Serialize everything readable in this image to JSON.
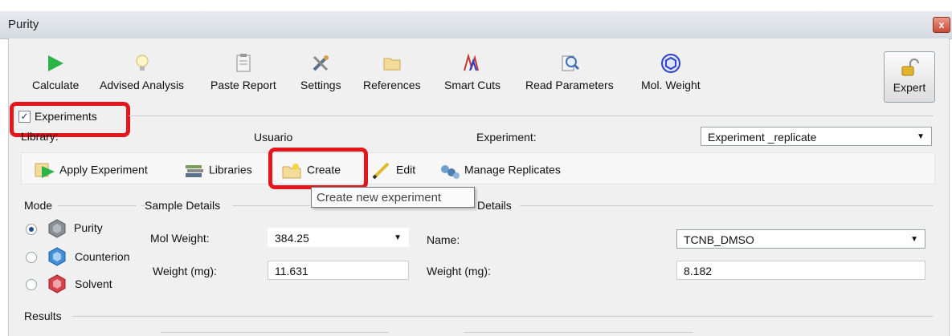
{
  "window": {
    "title": "Purity",
    "close_label": "x"
  },
  "toolbar": {
    "calculate": "Calculate",
    "advised_analysis": "Advised Analysis",
    "paste_report": "Paste Report",
    "settings": "Settings",
    "references": "References",
    "smart_cuts": "Smart Cuts",
    "read_parameters": "Read Parameters",
    "mol_weight": "Mol. Weight",
    "expert": "Expert"
  },
  "experiments": {
    "checkbox_label": "Experiments",
    "checked": true,
    "check_mark": "✓",
    "library_label": "Library:",
    "library_value": "Usuario",
    "experiment_label": "Experiment:",
    "experiment_value": "Experiment _replicate",
    "apply_experiment": "Apply Experiment",
    "libraries": "Libraries",
    "create": "Create",
    "edit": "Edit",
    "manage_replicates": "Manage Replicates",
    "tooltip": "Create new experiment"
  },
  "mode": {
    "title": "Mode",
    "options": [
      "Purity",
      "Counterion",
      "Solvent"
    ],
    "selected": "Purity"
  },
  "sample_details": {
    "title": "Sample Details",
    "mol_weight_label": "Mol Weight:",
    "mol_weight_value": "384.25",
    "weight_label": "Weight (mg):",
    "weight_value": "11.631"
  },
  "reference_details": {
    "title_visible_part": "Details",
    "name_label": "Name:",
    "name_value": "TCNB_DMSO",
    "weight_label": "Weight (mg):",
    "weight_value": "8.182"
  },
  "results": {
    "title": "Results"
  },
  "colors": {
    "highlight": "#e3161c",
    "calculate_green": "#2cb34a",
    "mol_weight_blue": "#2b3fd0",
    "counterion_blue": "#3f8fd9",
    "solvent_red": "#d8424a",
    "purity_gray": "#8a8f96"
  }
}
